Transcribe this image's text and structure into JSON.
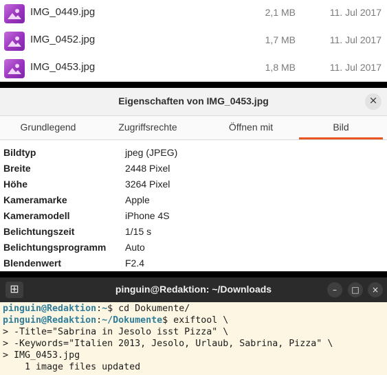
{
  "files": [
    {
      "name": "IMG_0449.jpg",
      "size": "2,1 MB",
      "date": "11. Jul 2017",
      "icon": "image-file-icon"
    },
    {
      "name": "IMG_0452.jpg",
      "size": "1,7 MB",
      "date": "11. Jul 2017",
      "icon": "image-file-icon"
    },
    {
      "name": "IMG_0453.jpg",
      "size": "1,8 MB",
      "date": "11. Jul 2017",
      "icon": "image-file-icon"
    }
  ],
  "properties": {
    "title": "Eigenschaften von IMG_0453.jpg",
    "close_icon": "×",
    "tabs": [
      "Grundlegend",
      "Zugriffsrechte",
      "Öffnen mit",
      "Bild"
    ],
    "active_tab": "Bild",
    "accent_color": "#e95420",
    "rows": [
      {
        "key": "Bildtyp",
        "value": "jpeg (JPEG)"
      },
      {
        "key": "Breite",
        "value": "2448 Pixel"
      },
      {
        "key": "Höhe",
        "value": "3264 Pixel"
      },
      {
        "key": "Kameramarke",
        "value": "Apple"
      },
      {
        "key": "Kameramodell",
        "value": "iPhone 4S"
      },
      {
        "key": "Belichtungszeit",
        "value": "1/15 s"
      },
      {
        "key": "Belichtungsprogramm",
        "value": "Auto"
      },
      {
        "key": "Blendenwert",
        "value": "F2.4"
      }
    ]
  },
  "terminal": {
    "title": "pinguin@Redaktion: ~/Downloads",
    "new_tab_icon": "⊞",
    "minimize_icon": "–",
    "maximize_icon": "□",
    "close_icon": "×",
    "lines": [
      {
        "user": "pinguin@Redaktion",
        "sep": ":",
        "path": "~",
        "rest": "$ cd Dokumente/"
      },
      {
        "user": "pinguin@Redaktion",
        "sep": ":",
        "path": "~/Dokumente",
        "rest": "$ exiftool \\"
      },
      {
        "text": "> -Title=\"Sabrina in Jesolo isst Pizza\" \\"
      },
      {
        "text": "> -Keywords=\"Italien 2013, Jesolo, Urlaub, Sabrina, Pizza\" \\"
      },
      {
        "text": "> IMG_0453.jpg"
      },
      {
        "text": "    1 image files updated"
      }
    ]
  }
}
